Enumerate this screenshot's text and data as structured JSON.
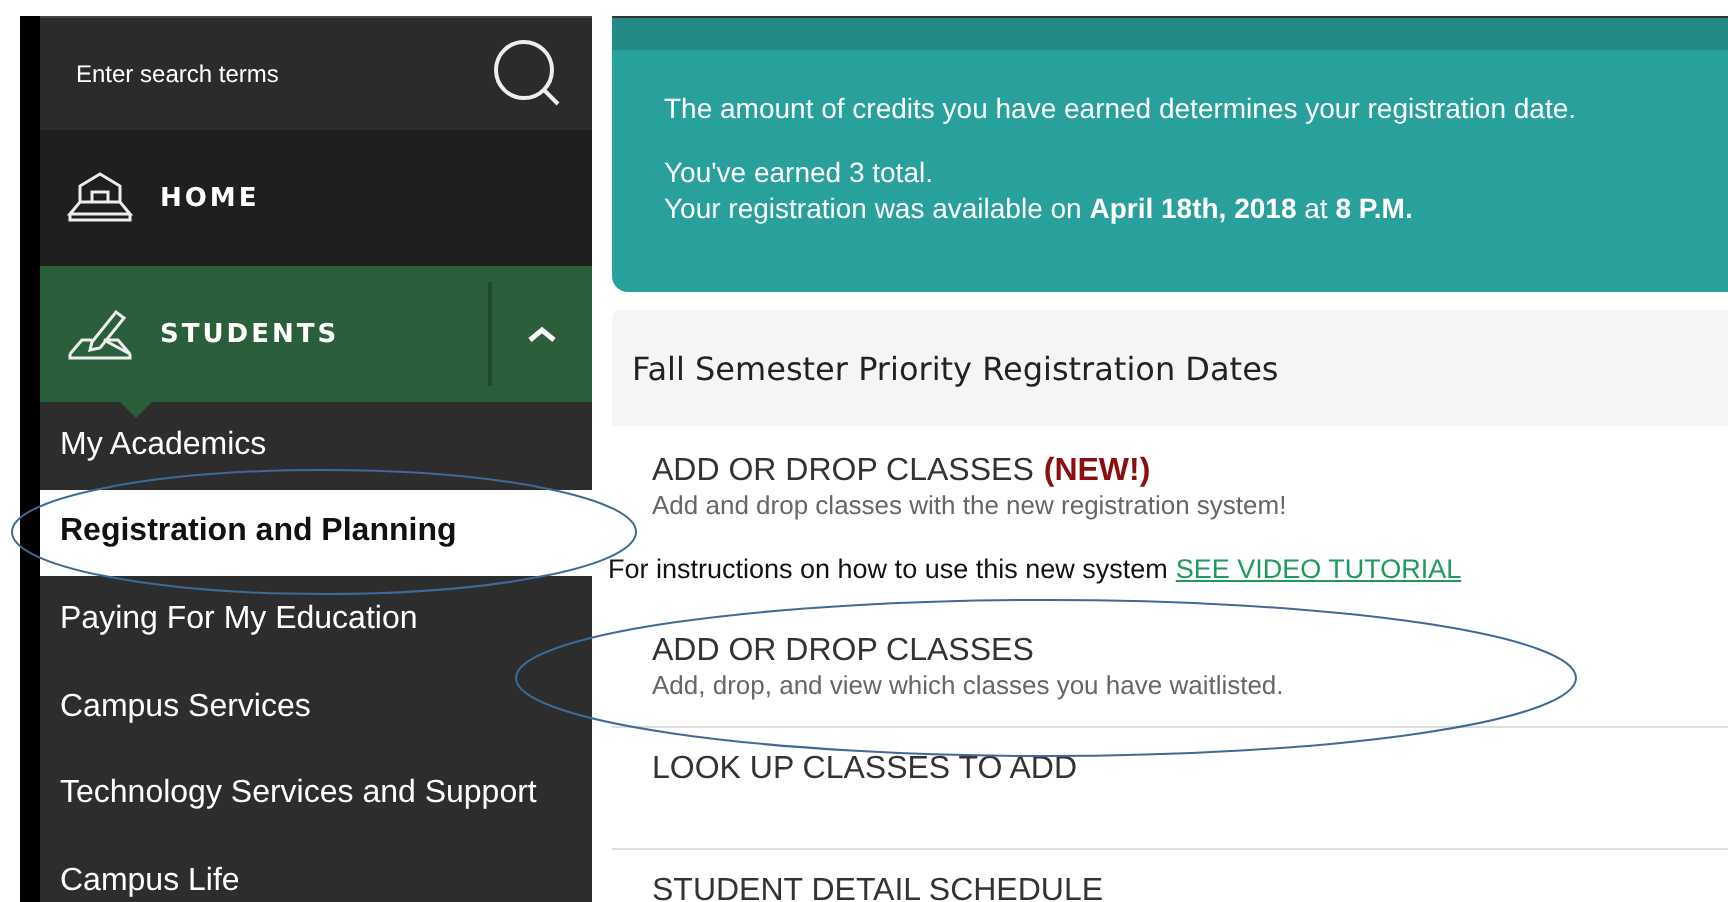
{
  "search": {
    "placeholder": "Enter search terms"
  },
  "nav": [
    {
      "label": "HOME",
      "kind": "home"
    },
    {
      "label": "STUDENTS",
      "kind": "students"
    }
  ],
  "subnav": [
    {
      "label": "My Academics",
      "selected": false
    },
    {
      "label": "Registration and Planning",
      "selected": true
    },
    {
      "label": "Paying For My Education",
      "selected": false
    },
    {
      "label": "Campus Services",
      "selected": false
    },
    {
      "label": "Technology Services and Support",
      "selected": false
    },
    {
      "label": "Campus Life",
      "selected": false
    }
  ],
  "info": {
    "lead": "The amount of credits you have earned determines your registration date.",
    "lines": [
      "You've earned 3 total.",
      "Your registration was available on **April 18th, 2018** at **8 P.M.**"
    ]
  },
  "section_title": "Fall Semester Priority Registration Dates",
  "entries": [
    {
      "kind": "link",
      "title": "ADD OR DROP CLASSES",
      "badge": "(NEW!)",
      "description": "Add and drop classes with the new registration system!"
    },
    {
      "kind": "note",
      "text": "For instructions on how to use this new system",
      "link": "SEE VIDEO TUTORIAL"
    },
    {
      "kind": "link",
      "title": "ADD OR DROP CLASSES",
      "description": "Add, drop, and view which classes you have waitlisted."
    },
    {
      "kind": "link",
      "title": "LOOK UP CLASSES TO ADD"
    },
    {
      "kind": "link",
      "title": "STUDENT DETAIL SCHEDULE"
    }
  ]
}
